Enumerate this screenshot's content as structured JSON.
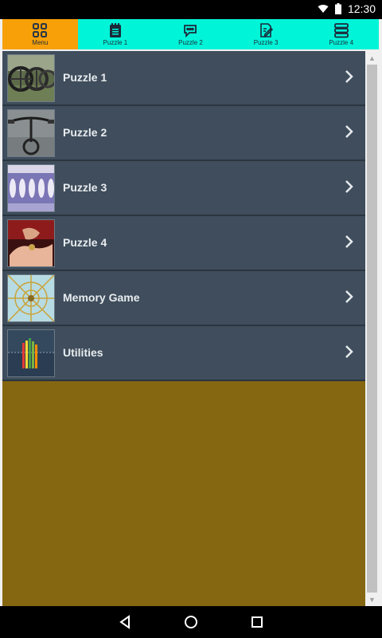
{
  "status": {
    "time": "12:30",
    "icons": [
      "wifi-icon",
      "battery-icon"
    ]
  },
  "tabs": [
    {
      "label": "Menu",
      "icon": "grid-icon",
      "active": true
    },
    {
      "label": "Puzzle 1",
      "icon": "notepad-icon",
      "active": false
    },
    {
      "label": "Puzzle 2",
      "icon": "chat-icon",
      "active": false
    },
    {
      "label": "Puzzle 3",
      "icon": "edit-icon",
      "active": false
    },
    {
      "label": "Puzzle 4",
      "icon": "stack-icon",
      "active": false
    }
  ],
  "menu": {
    "items": [
      {
        "label": "Puzzle 1",
        "thumb": "wheels-thumbnail"
      },
      {
        "label": "Puzzle 2",
        "thumb": "bicycle-thumbnail"
      },
      {
        "label": "Puzzle 3",
        "thumb": "balustrade-thumbnail"
      },
      {
        "label": "Puzzle 4",
        "thumb": "hands-thumbnail"
      },
      {
        "label": "Memory Game",
        "thumb": "pattern-thumbnail"
      },
      {
        "label": "Utilities",
        "thumb": "pencils-thumbnail"
      }
    ]
  },
  "nav": {
    "icons": [
      "back-icon",
      "home-icon",
      "recents-icon"
    ]
  },
  "colors": {
    "tab_bar": "#00f5d8",
    "tab_active": "#f7a008",
    "list_item": "#3f4d5c",
    "background": "#866711"
  }
}
